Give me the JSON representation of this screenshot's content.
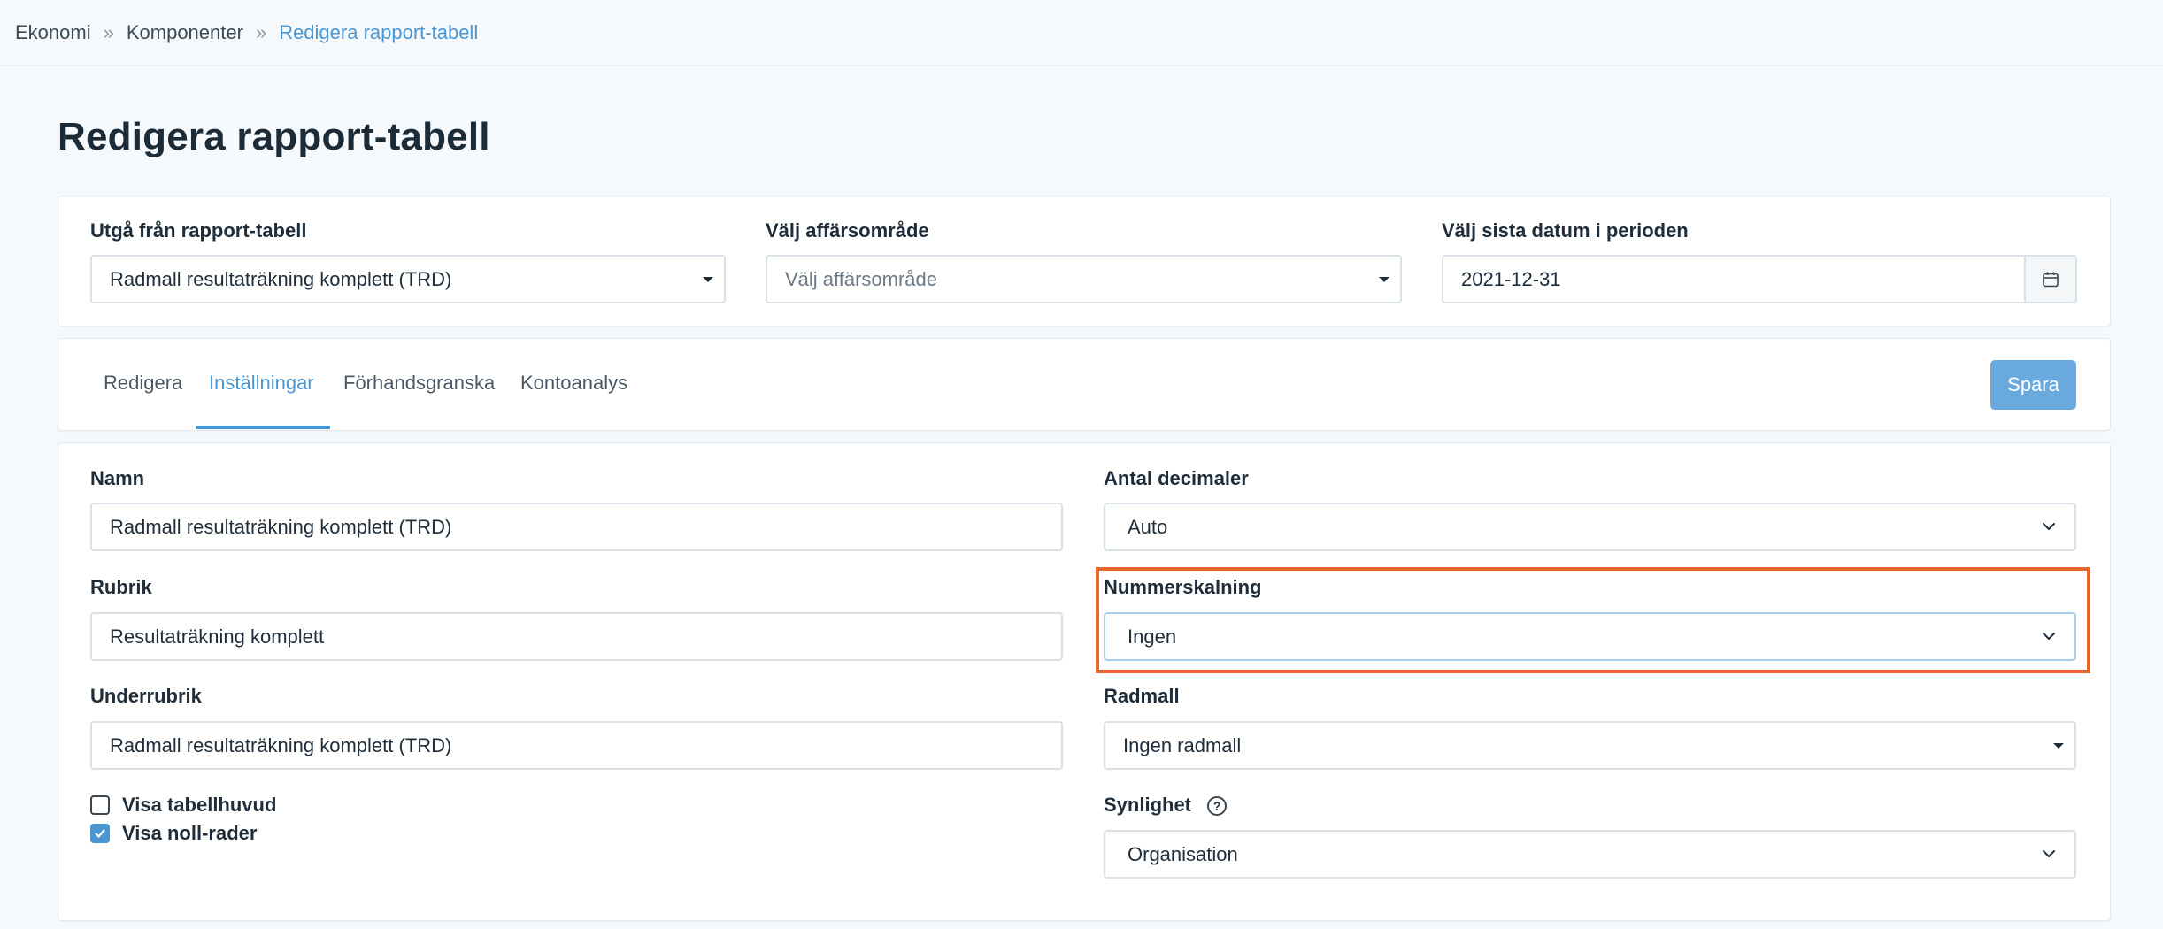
{
  "breadcrumb": {
    "items": [
      "Ekonomi",
      "Komponenter",
      "Redigera rapport-tabell"
    ],
    "separator": "»"
  },
  "page_title": "Redigera rapport-tabell",
  "filters": {
    "base_label": "Utgå från rapport-tabell",
    "base_value": "Radmall resultaträkning komplett (TRD)",
    "area_label": "Välj affärsområde",
    "area_placeholder": "Välj affärsområde",
    "date_label": "Välj sista datum i perioden",
    "date_value": "2021-12-31"
  },
  "tabs": {
    "items": [
      "Redigera",
      "Inställningar",
      "Förhandsgranska",
      "Kontoanalys"
    ],
    "active": "Inställningar",
    "save_label": "Spara"
  },
  "form": {
    "name_label": "Namn",
    "name_value": "Radmall resultaträkning komplett (TRD)",
    "heading_label": "Rubrik",
    "heading_value": "Resultaträkning komplett",
    "subheading_label": "Underrubrik",
    "subheading_value": "Radmall resultaträkning komplett (TRD)",
    "decimals_label": "Antal decimaler",
    "decimals_value": "Auto",
    "scaling_label": "Nummerskalning",
    "scaling_value": "Ingen",
    "template_label": "Radmall",
    "template_value": "Ingen radmall",
    "visibility_label": "Synlighet",
    "visibility_value": "Organisation",
    "show_header_label": "Visa tabellhuvud",
    "show_header_checked": false,
    "show_zero_label": "Visa noll-rader",
    "show_zero_checked": true
  },
  "colors": {
    "accent": "#4a96d2",
    "highlight": "#e8652c",
    "save_button": "#6aa9de"
  }
}
